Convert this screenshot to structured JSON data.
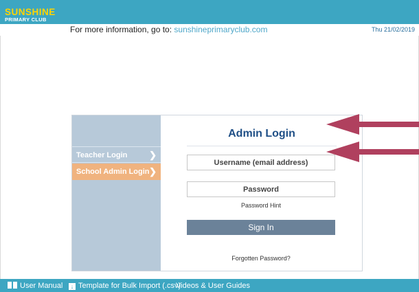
{
  "header": {
    "logo_main": "SUNSHINE",
    "logo_sub": "PRIMARY CLUB"
  },
  "infobar": {
    "text": "For more information, go to: ",
    "link": "sunshineprimaryclub.com",
    "date": "Thu 21/02/2019"
  },
  "sidebar": {
    "items": [
      {
        "label": "Teacher Login",
        "active": false
      },
      {
        "label": "School Admin Login",
        "active": true
      }
    ]
  },
  "form": {
    "title": "Admin Login",
    "username_placeholder": "Username (email address)",
    "password_placeholder": "Password",
    "password_hint": "Password Hint",
    "sign_in_label": "Sign In",
    "forgotten_password": "Forgotten Password?"
  },
  "footer": {
    "items": [
      {
        "label": "User Manual",
        "icon": "book-icon"
      },
      {
        "label": "Template for Bulk Import (.csv)",
        "icon": "download-icon"
      },
      {
        "label": "Videos & User Guides",
        "icon": ""
      }
    ]
  },
  "colors": {
    "brand": "#3da6c2",
    "logo_yellow": "#ffd400",
    "active_tab": "#f0b37f",
    "sidebar": "#b7c9d9",
    "title": "#1f4f86",
    "button": "#6b8299",
    "arrow": "#b0405e"
  }
}
